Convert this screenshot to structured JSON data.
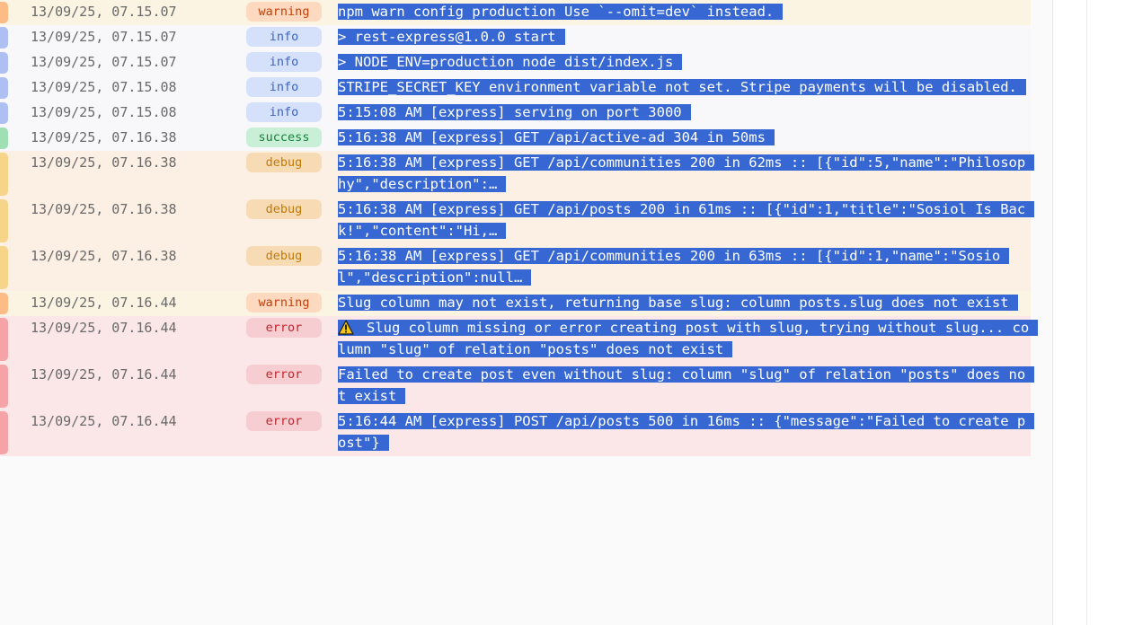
{
  "log": {
    "rows": [
      {
        "timestamp": "13/09/25, 07.15.07",
        "level": "warning",
        "message": "npm warn config production Use `--omit=dev` instead."
      },
      {
        "timestamp": "13/09/25, 07.15.07",
        "level": "info",
        "message": "> rest-express@1.0.0 start"
      },
      {
        "timestamp": "13/09/25, 07.15.07",
        "level": "info",
        "message": "> NODE_ENV=production node dist/index.js"
      },
      {
        "timestamp": "13/09/25, 07.15.08",
        "level": "info",
        "message": "STRIPE_SECRET_KEY environment variable not set. Stripe payments will be disabled."
      },
      {
        "timestamp": "13/09/25, 07.15.08",
        "level": "info",
        "message": "5:15:08 AM [express] serving on port 3000"
      },
      {
        "timestamp": "13/09/25, 07.16.38",
        "level": "success",
        "message": "5:16:38 AM [express] GET /api/active-ad 304 in 50ms"
      },
      {
        "timestamp": "13/09/25, 07.16.38",
        "level": "debug",
        "message": "5:16:38 AM [express] GET /api/communities 200 in 62ms :: [{\"id\":5,\"name\":\"Philosophy\",\"description\":…"
      },
      {
        "timestamp": "13/09/25, 07.16.38",
        "level": "debug",
        "message": "5:16:38 AM [express] GET /api/posts 200 in 61ms :: [{\"id\":1,\"title\":\"Sosiol Is Back!\",\"content\":\"Hi,…"
      },
      {
        "timestamp": "13/09/25, 07.16.38",
        "level": "debug",
        "message": "5:16:38 AM [express] GET /api/communities 200 in 63ms :: [{\"id\":1,\"name\":\"Sosiol\",\"description\":null…"
      },
      {
        "timestamp": "13/09/25, 07.16.44",
        "level": "warning",
        "message": "Slug column may not exist, returning base slug: column posts.slug does not exist"
      },
      {
        "timestamp": "13/09/25, 07.16.44",
        "level": "error",
        "icon": "warning-sign-icon",
        "message": "Slug column missing or error creating post with slug, trying without slug... column \"slug\" of relation \"posts\" does not exist"
      },
      {
        "timestamp": "13/09/25, 07.16.44",
        "level": "error",
        "message": "Failed to create post even without slug: column \"slug\" of relation \"posts\" does not exist"
      },
      {
        "timestamp": "13/09/25, 07.16.44",
        "level": "error",
        "message": "5:16:44 AM [express] POST /api/posts 500 in 16ms :: {\"message\":\"Failed to create post\"}"
      }
    ]
  },
  "colors": {
    "selection": "#3767d3",
    "warning": "#c2410c",
    "info": "#3b63c9",
    "success": "#15803d",
    "debug": "#c27a08",
    "error": "#c0272d"
  }
}
